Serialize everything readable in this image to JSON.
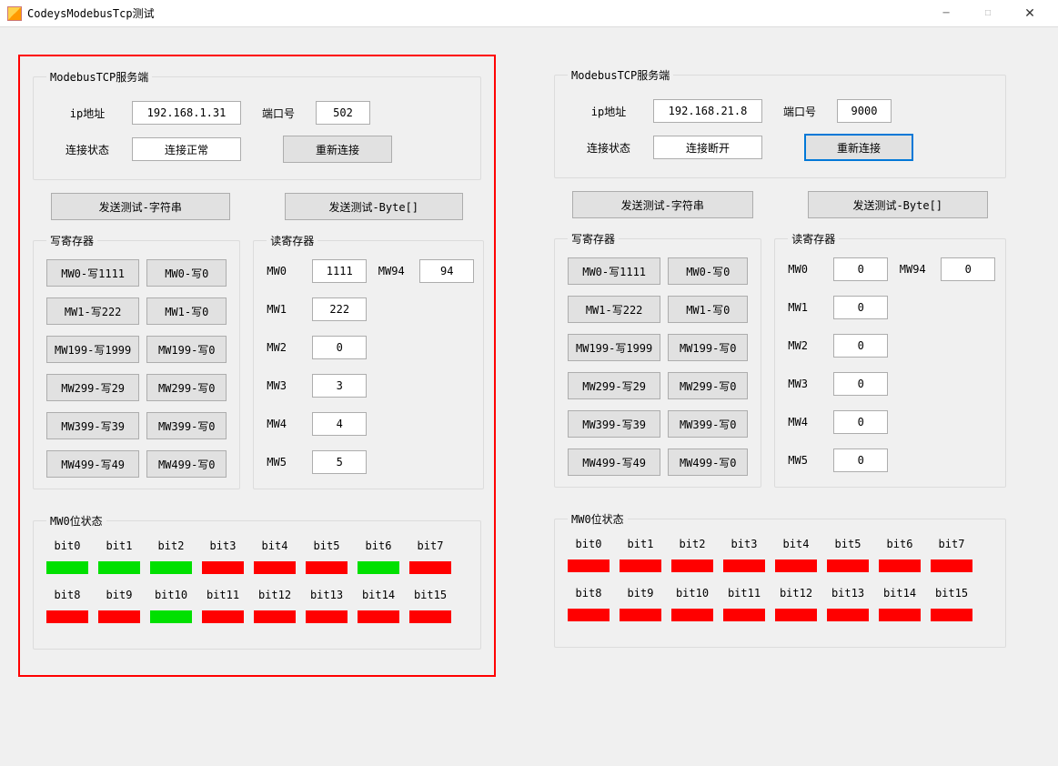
{
  "window": {
    "title": "CodeysModebusTcp测试",
    "minimize": "─",
    "maximize": "□",
    "close": "✕"
  },
  "common": {
    "server_group_title": "ModebusTCP服务端",
    "ip_label": "ip地址",
    "port_label": "端口号",
    "conn_status_label": "连接状态",
    "reconnect_btn": "重新连接",
    "send_string_btn": "发送测试-字符串",
    "send_bytes_btn": "发送测试-Byte[]",
    "write_group_title": "写寄存器",
    "read_group_title": "读寄存器",
    "bits_group_title": "MW0位状态"
  },
  "left": {
    "ip": "192.168.1.31",
    "port": "502",
    "conn_status": "连接正常",
    "reconnect_focused": false,
    "write_buttons": [
      [
        "MW0-写1111",
        "MW0-写0"
      ],
      [
        "MW1-写222",
        "MW1-写0"
      ],
      [
        "MW199-写1999",
        "MW199-写0"
      ],
      [
        "MW299-写29",
        "MW299-写0"
      ],
      [
        "MW399-写39",
        "MW399-写0"
      ],
      [
        "MW499-写49",
        "MW499-写0"
      ]
    ],
    "read": [
      {
        "label": "MW0",
        "value": "1111",
        "label2": "MW94",
        "value2": "94"
      },
      {
        "label": "MW1",
        "value": "222"
      },
      {
        "label": "MW2",
        "value": "0"
      },
      {
        "label": "MW3",
        "value": "3"
      },
      {
        "label": "MW4",
        "value": "4"
      },
      {
        "label": "MW5",
        "value": "5"
      }
    ],
    "bits_labels": [
      "bit0",
      "bit1",
      "bit2",
      "bit3",
      "bit4",
      "bit5",
      "bit6",
      "bit7",
      "bit8",
      "bit9",
      "bit10",
      "bit11",
      "bit12",
      "bit13",
      "bit14",
      "bit15"
    ],
    "bits_state": [
      1,
      1,
      1,
      0,
      0,
      0,
      1,
      0,
      0,
      0,
      1,
      0,
      0,
      0,
      0,
      0
    ]
  },
  "right": {
    "ip": "192.168.21.8",
    "port": "9000",
    "conn_status": "连接断开",
    "reconnect_focused": true,
    "write_buttons": [
      [
        "MW0-写1111",
        "MW0-写0"
      ],
      [
        "MW1-写222",
        "MW1-写0"
      ],
      [
        "MW199-写1999",
        "MW199-写0"
      ],
      [
        "MW299-写29",
        "MW299-写0"
      ],
      [
        "MW399-写39",
        "MW399-写0"
      ],
      [
        "MW499-写49",
        "MW499-写0"
      ]
    ],
    "read": [
      {
        "label": "MW0",
        "value": "0",
        "label2": "MW94",
        "value2": "0"
      },
      {
        "label": "MW1",
        "value": "0"
      },
      {
        "label": "MW2",
        "value": "0"
      },
      {
        "label": "MW3",
        "value": "0"
      },
      {
        "label": "MW4",
        "value": "0"
      },
      {
        "label": "MW5",
        "value": "0"
      }
    ],
    "bits_labels": [
      "bit0",
      "bit1",
      "bit2",
      "bit3",
      "bit4",
      "bit5",
      "bit6",
      "bit7",
      "bit8",
      "bit9",
      "bit10",
      "bit11",
      "bit12",
      "bit13",
      "bit14",
      "bit15"
    ],
    "bits_state": [
      0,
      0,
      0,
      0,
      0,
      0,
      0,
      0,
      0,
      0,
      0,
      0,
      0,
      0,
      0,
      0
    ]
  }
}
